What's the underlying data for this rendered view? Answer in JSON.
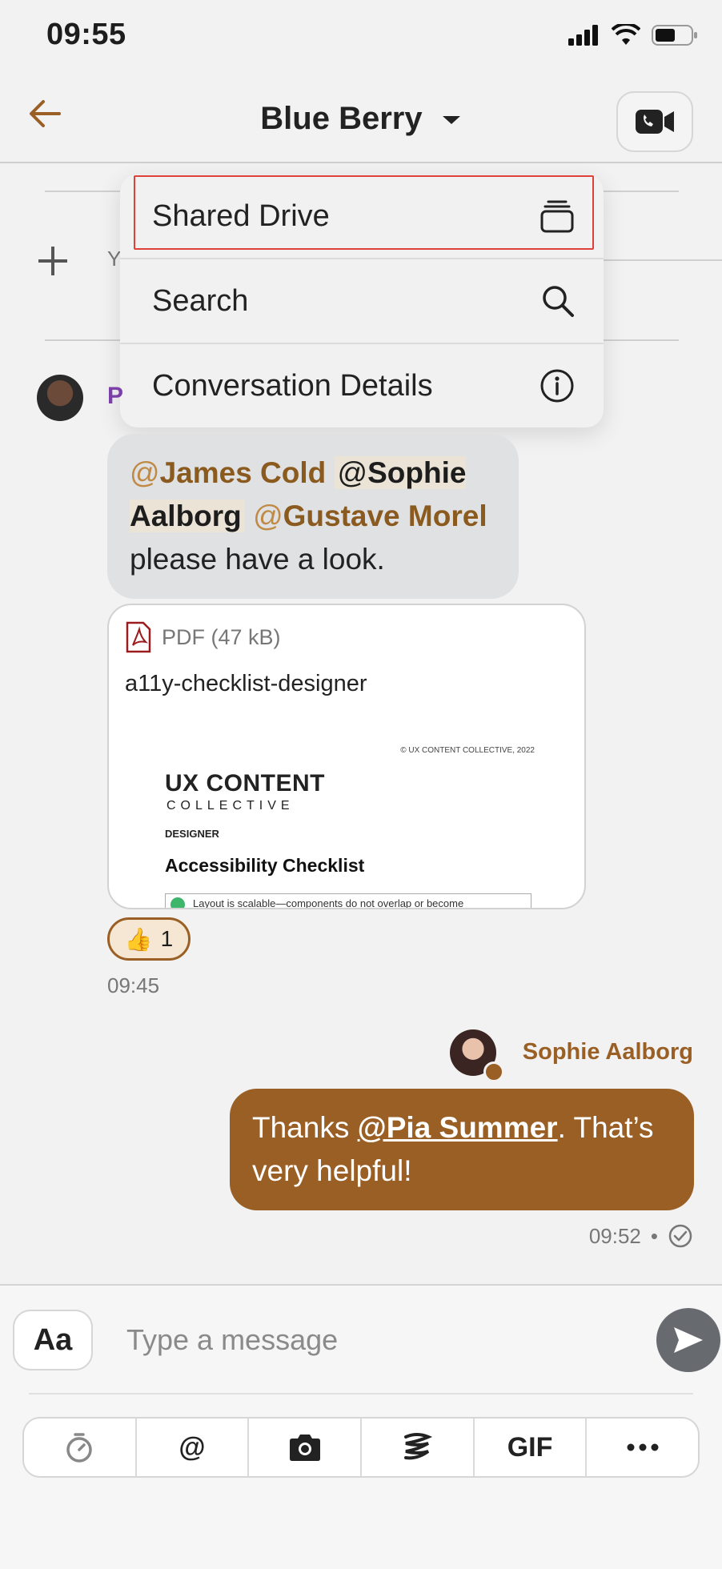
{
  "status_bar": {
    "time": "09:55"
  },
  "header": {
    "title": "Blue Berry"
  },
  "background": {
    "partial_text": "Y"
  },
  "menu": {
    "items": [
      {
        "label": "Shared Drive",
        "icon": "stack-icon"
      },
      {
        "label": "Search",
        "icon": "search-icon"
      },
      {
        "label": "Conversation Details",
        "icon": "info-icon"
      }
    ]
  },
  "messages": {
    "pia": {
      "sender_initial": "P",
      "mentions": [
        "James Cold",
        "Sophie Aalborg",
        "Gustave Morel"
      ],
      "text": "please have a look.",
      "attachment": {
        "type_label": "PDF (47 kB)",
        "file_name": "a11y-checklist-designer",
        "preview": {
          "copyright": "© UX CONTENT COLLECTIVE, 2022",
          "brand_line1": "UX CONTENT",
          "brand_line2": "COLLECTIVE",
          "role": "DESIGNER",
          "title": "Accessibility Checklist",
          "first_item": "Layout is scalable—components do not overlap or become"
        }
      },
      "reaction": {
        "emoji": "👍",
        "count": "1"
      },
      "time": "09:45"
    },
    "sophie": {
      "sender": "Sophie Aalborg",
      "text_before": "Thanks ",
      "mention": "@Pia Summer",
      "text_after": ". That’s very helpful!",
      "time": "09:52",
      "separator": "•"
    }
  },
  "composer": {
    "format_label": "Aa",
    "placeholder": "Type a message",
    "toolbar": [
      "timer-icon",
      "@",
      "camera-icon",
      "giphy-icon",
      "GIF",
      "more-icon"
    ]
  },
  "colors": {
    "accent": "#9a5f25",
    "highlight": "#e0403a"
  }
}
